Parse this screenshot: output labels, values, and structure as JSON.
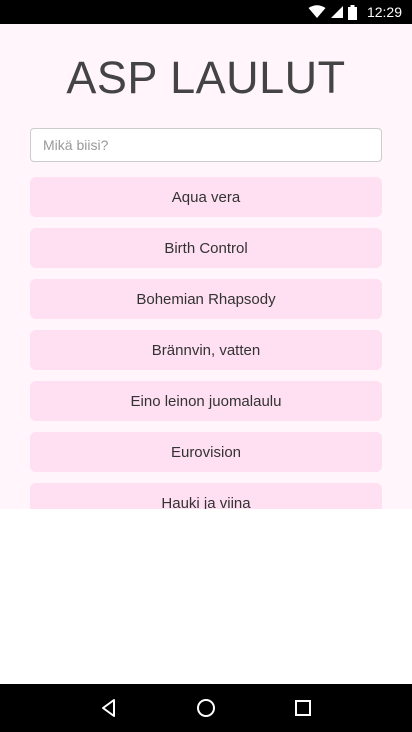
{
  "status_bar": {
    "time": "12:29",
    "icons": [
      "wifi-icon",
      "cellular-signal-icon",
      "battery-icon"
    ]
  },
  "app": {
    "title": "ASP LAULUT",
    "search": {
      "placeholder": "Mikä biisi?",
      "value": ""
    },
    "songs": [
      "Aqua vera",
      "Birth Control",
      "Bohemian Rhapsody",
      "Brännvin, vatten",
      "Eino leinon juomalaulu",
      "Eurovision",
      "Hauki ja viina"
    ],
    "colors": {
      "background": "#fff5fa",
      "button": "#ffdff2",
      "title": "#444444"
    }
  },
  "nav_bar": {
    "buttons": [
      "back-icon",
      "home-icon",
      "recents-icon"
    ]
  }
}
